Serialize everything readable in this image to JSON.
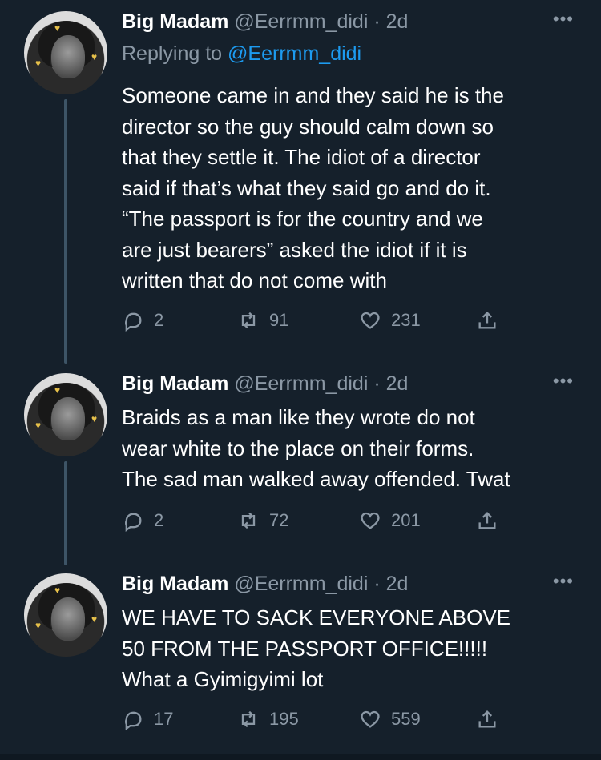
{
  "tweets": [
    {
      "display_name": "Big Madam",
      "handle_time": "@Eerrmm_didi · 2d",
      "replying_prefix": "Replying to ",
      "replying_to": "@Eerrmm_didi",
      "lines": [
        "Someone came in and they said he is the",
        "director so the guy should calm down so",
        "that they settle it. The idiot of a director",
        "said if that’s what they said go and do it.",
        "“The passport is for the country and we",
        "are just bearers” asked the idiot if it is",
        "written that do not come with"
      ],
      "replies": "2",
      "retweets": "91",
      "likes": "231",
      "more": "•••"
    },
    {
      "display_name": "Big Madam",
      "handle_time": "@Eerrmm_didi · 2d",
      "lines": [
        "Braids as a man like they wrote do not",
        "wear white to the place on their forms.",
        "The sad man walked away offended. Twat"
      ],
      "replies": "2",
      "retweets": "72",
      "likes": "201",
      "more": "•••"
    },
    {
      "display_name": "Big Madam",
      "handle_time": "@Eerrmm_didi · 2d",
      "lines": [
        "WE HAVE TO SACK EVERYONE ABOVE",
        "50 FROM THE PASSPORT OFFICE!!!!!",
        "What a Gyimigyimi lot"
      ],
      "replies": "17",
      "retweets": "195",
      "likes": "559",
      "more": "•••"
    }
  ],
  "icons": {
    "reply": "reply-icon",
    "retweet": "retweet-icon",
    "like": "heart-icon",
    "share": "share-icon",
    "more": "more-options-icon"
  },
  "colors": {
    "background": "#15202b",
    "secondary_text": "#8b98a5",
    "link": "#1d9bf0",
    "thread_line": "#3d5466"
  }
}
